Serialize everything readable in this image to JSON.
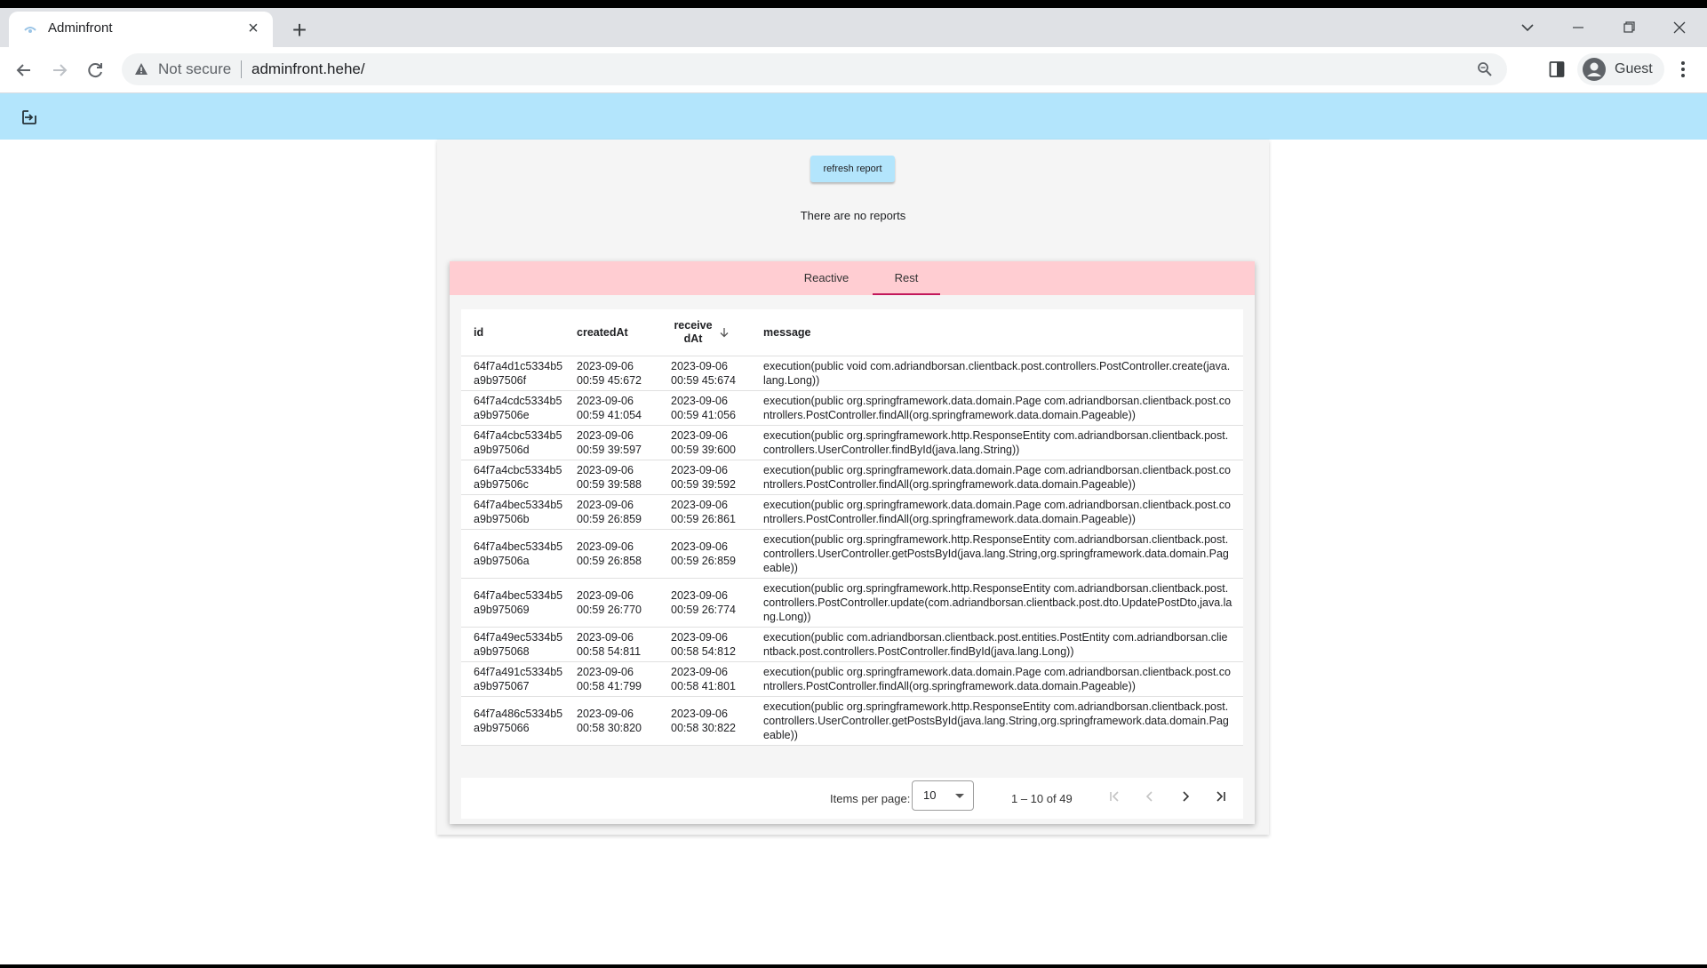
{
  "browser": {
    "tab_title": "Adminfront",
    "security_label": "Not secure",
    "url": "adminfront.hehe/",
    "profile_label": "Guest"
  },
  "page": {
    "refresh_label": "refresh report",
    "empty_message": "There are no reports",
    "tabs": [
      {
        "label": "Reactive",
        "active": false
      },
      {
        "label": "Rest",
        "active": true
      }
    ]
  },
  "table": {
    "columns": [
      "id",
      "createdAt",
      "receivedAt",
      "message"
    ],
    "rows": [
      {
        "id": "64f7a4d1c5334b5a9b97506f",
        "createdAt": "2023-09-06 00:59 45:672",
        "receivedAt": "2023-09-06 00:59 45:674",
        "message": "execution(public void com.adriandborsan.clientback.post.controllers.PostController.create(java.lang.Long))"
      },
      {
        "id": "64f7a4cdc5334b5a9b97506e",
        "createdAt": "2023-09-06 00:59 41:054",
        "receivedAt": "2023-09-06 00:59 41:056",
        "message": "execution(public org.springframework.data.domain.Page com.adriandborsan.clientback.post.controllers.PostController.findAll(org.springframework.data.domain.Pageable))"
      },
      {
        "id": "64f7a4cbc5334b5a9b97506d",
        "createdAt": "2023-09-06 00:59 39:597",
        "receivedAt": "2023-09-06 00:59 39:600",
        "message": "execution(public org.springframework.http.ResponseEntity com.adriandborsan.clientback.post.controllers.UserController.findById(java.lang.String))"
      },
      {
        "id": "64f7a4cbc5334b5a9b97506c",
        "createdAt": "2023-09-06 00:59 39:588",
        "receivedAt": "2023-09-06 00:59 39:592",
        "message": "execution(public org.springframework.data.domain.Page com.adriandborsan.clientback.post.controllers.PostController.findAll(org.springframework.data.domain.Pageable))"
      },
      {
        "id": "64f7a4bec5334b5a9b97506b",
        "createdAt": "2023-09-06 00:59 26:859",
        "receivedAt": "2023-09-06 00:59 26:861",
        "message": "execution(public org.springframework.data.domain.Page com.adriandborsan.clientback.post.controllers.PostController.findAll(org.springframework.data.domain.Pageable))"
      },
      {
        "id": "64f7a4bec5334b5a9b97506a",
        "createdAt": "2023-09-06 00:59 26:858",
        "receivedAt": "2023-09-06 00:59 26:859",
        "message": "execution(public org.springframework.http.ResponseEntity com.adriandborsan.clientback.post.controllers.UserController.getPostsById(java.lang.String,org.springframework.data.domain.Pageable))"
      },
      {
        "id": "64f7a4bec5334b5a9b975069",
        "createdAt": "2023-09-06 00:59 26:770",
        "receivedAt": "2023-09-06 00:59 26:774",
        "message": "execution(public org.springframework.http.ResponseEntity com.adriandborsan.clientback.post.controllers.PostController.update(com.adriandborsan.clientback.post.dto.UpdatePostDto,java.lang.Long))"
      },
      {
        "id": "64f7a49ec5334b5a9b975068",
        "createdAt": "2023-09-06 00:58 54:811",
        "receivedAt": "2023-09-06 00:58 54:812",
        "message": "execution(public com.adriandborsan.clientback.post.entities.PostEntity com.adriandborsan.clientback.post.controllers.PostController.findById(java.lang.Long))"
      },
      {
        "id": "64f7a491c5334b5a9b975067",
        "createdAt": "2023-09-06 00:58 41:799",
        "receivedAt": "2023-09-06 00:58 41:801",
        "message": "execution(public org.springframework.data.domain.Page com.adriandborsan.clientback.post.controllers.PostController.findAll(org.springframework.data.domain.Pageable))"
      },
      {
        "id": "64f7a486c5334b5a9b975066",
        "createdAt": "2023-09-06 00:58 30:820",
        "receivedAt": "2023-09-06 00:58 30:822",
        "message": "execution(public org.springframework.http.ResponseEntity com.adriandborsan.clientback.post.controllers.UserController.getPostsById(java.lang.String,org.springframework.data.domain.Pageable))"
      }
    ]
  },
  "paginator": {
    "items_per_page_label": "Items per page:",
    "items_per_page_value": "10",
    "range_label": "1 – 10 of 49"
  },
  "colors": {
    "app_toolbar": "#b3e5fc",
    "tabs_header": "#ffcdd2",
    "active_tab_ink": "#c2185b"
  },
  "icons": [
    "logout-icon",
    "sort-descending-icon",
    "first-page-icon",
    "previous-page-icon",
    "next-page-icon",
    "last-page-icon"
  ]
}
